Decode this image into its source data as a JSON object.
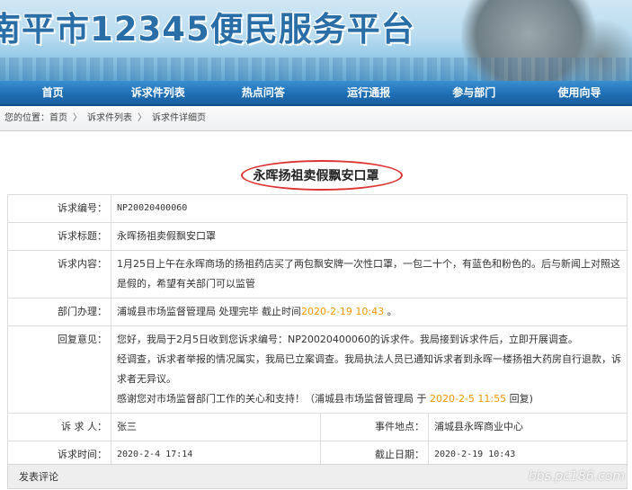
{
  "banner": {
    "title": "南平市12345便民服务平台"
  },
  "nav": {
    "items": [
      "首页",
      "诉求件列表",
      "热点问答",
      "运行通报",
      "参与部门",
      "使用向导"
    ]
  },
  "breadcrumb": {
    "prefix": "您的位置：",
    "items": [
      "首页",
      "诉求件列表",
      "诉求件详细页"
    ],
    "sep": "〉"
  },
  "detail": {
    "title": "永晖扬祖卖假飘安口罩",
    "rows": {
      "id_label": "诉求编号：",
      "id_value": "NP20020400060",
      "subject_label": "诉求标题：",
      "subject_value": "永晖扬祖卖假飘安口罩",
      "content_label": "诉求内容：",
      "content_value": "1月25日上午在永晖商场的扬祖药店买了两包飘安牌一次性口罩，一包二十个，有蓝色和粉色的。后与新闻上对照这是假的，希望有关部门可以监管",
      "dept_label": "部门办理：",
      "dept_value": "浦城县市场监督管理局 处理完毕  截止时间",
      "dept_deadline": "2020-2-19 10:43",
      "dept_suffix": " 。",
      "reply_label": "回复意见：",
      "reply_line1": "您好，我局于2月5日收到您诉求编号：NP20020400060的诉求件。我局接到诉求件后，立即开展调查。",
      "reply_line2": "经调查，诉求者举报的情况属实，我局已立案调查。我局执法人员已通知诉求者到永晖一楼扬祖大药房自行退款，诉求者无异议。",
      "reply_line3a": "感谢您对市场监督部门工作的关心和支持！（浦城县市场监督管理局 于 ",
      "reply_date": "2020-2-5 11:55",
      "reply_line3b": " 回复)",
      "requester_label": "诉 求 人：",
      "requester_value": "张三",
      "location_label": "事件地点：",
      "location_value": "浦城县永晖商业中心",
      "time_label": "诉求时间：",
      "time_value": "2020-2-4 17:14",
      "deadline_label": "截止日期：",
      "deadline_value": "2020-2-19 10:43"
    }
  },
  "comment_bar": {
    "label": "发表评论"
  },
  "watermark": "bbs.pc186.com",
  "colors": {
    "nav_blue": "#1f6fb5",
    "highlight_orange": "#f39800",
    "circle_red": "#dd3333"
  }
}
